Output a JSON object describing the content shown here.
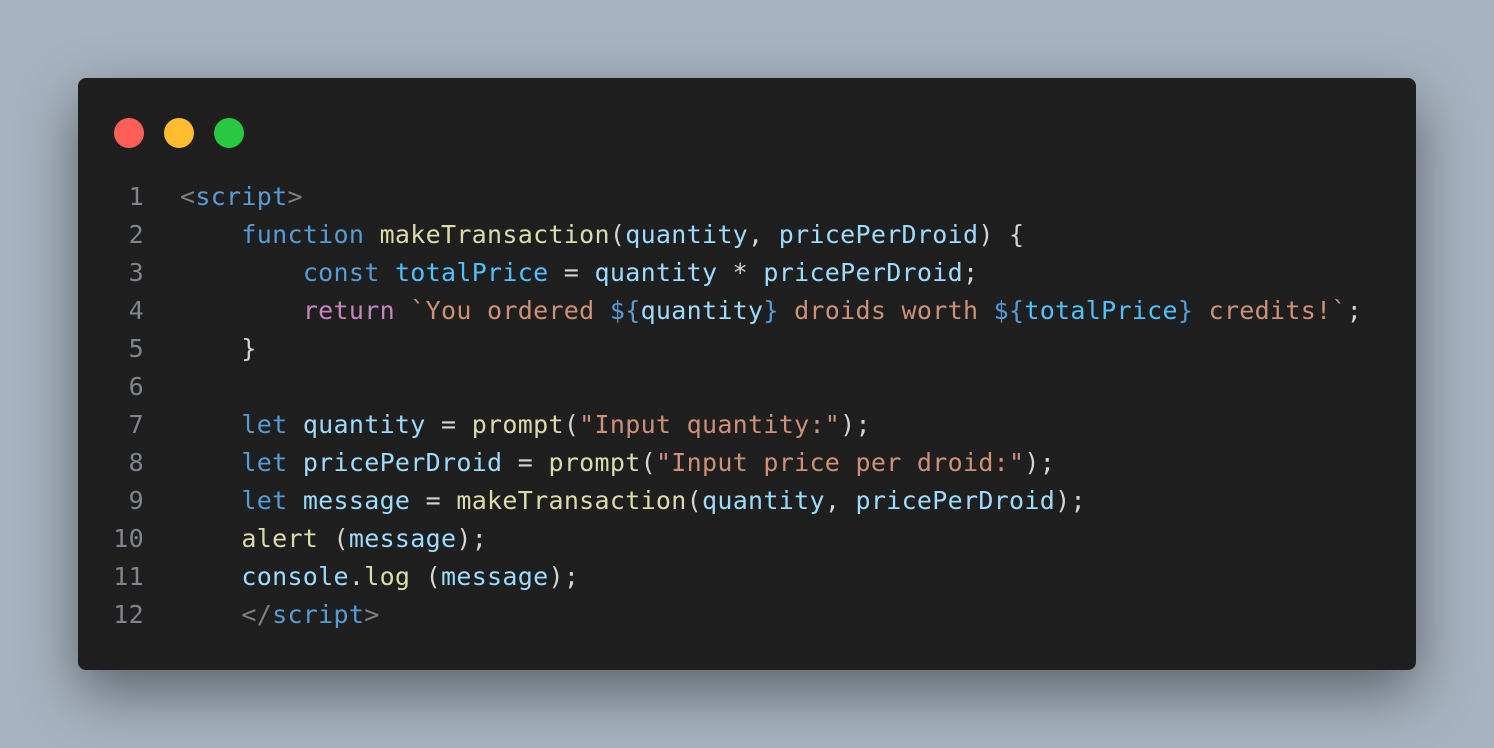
{
  "window": {
    "controls": [
      {
        "name": "close-button",
        "color": "#ff5f57"
      },
      {
        "name": "minimize-button",
        "color": "#febc2e"
      },
      {
        "name": "maximize-button",
        "color": "#28c840"
      }
    ]
  },
  "colors": {
    "background": "#a7b3c0",
    "editor": "#1f1f1f",
    "line_number": "#7f868f"
  },
  "code": {
    "lines": [
      {
        "number": "1",
        "tokens": [
          {
            "type": "tag-br",
            "text": "<"
          },
          {
            "type": "tag",
            "text": "script"
          },
          {
            "type": "tag-br",
            "text": ">"
          }
        ]
      },
      {
        "number": "2",
        "tokens": [
          {
            "type": "punc",
            "text": "    "
          },
          {
            "type": "kw",
            "text": "function"
          },
          {
            "type": "punc",
            "text": " "
          },
          {
            "type": "fn",
            "text": "makeTransaction"
          },
          {
            "type": "punc",
            "text": "("
          },
          {
            "type": "var",
            "text": "quantity"
          },
          {
            "type": "punc",
            "text": ", "
          },
          {
            "type": "var",
            "text": "pricePerDroid"
          },
          {
            "type": "punc",
            "text": ") {"
          }
        ]
      },
      {
        "number": "3",
        "tokens": [
          {
            "type": "punc",
            "text": "        "
          },
          {
            "type": "kw",
            "text": "const"
          },
          {
            "type": "punc",
            "text": " "
          },
          {
            "type": "const",
            "text": "totalPrice"
          },
          {
            "type": "punc",
            "text": " = "
          },
          {
            "type": "var",
            "text": "quantity"
          },
          {
            "type": "punc",
            "text": " * "
          },
          {
            "type": "var",
            "text": "pricePerDroid"
          },
          {
            "type": "punc",
            "text": ";"
          }
        ]
      },
      {
        "number": "4",
        "tokens": [
          {
            "type": "punc",
            "text": "        "
          },
          {
            "type": "ctrl",
            "text": "return"
          },
          {
            "type": "punc",
            "text": " "
          },
          {
            "type": "str",
            "text": "`You ordered "
          },
          {
            "type": "kw",
            "text": "${"
          },
          {
            "type": "var",
            "text": "quantity"
          },
          {
            "type": "kw",
            "text": "}"
          },
          {
            "type": "str",
            "text": " droids worth "
          },
          {
            "type": "kw",
            "text": "${"
          },
          {
            "type": "const",
            "text": "totalPrice"
          },
          {
            "type": "kw",
            "text": "}"
          },
          {
            "type": "str",
            "text": " credits!`"
          },
          {
            "type": "punc",
            "text": ";"
          }
        ]
      },
      {
        "number": "5",
        "tokens": [
          {
            "type": "punc",
            "text": "    }"
          }
        ]
      },
      {
        "number": "6",
        "tokens": []
      },
      {
        "number": "7",
        "tokens": [
          {
            "type": "punc",
            "text": "    "
          },
          {
            "type": "kw",
            "text": "let"
          },
          {
            "type": "punc",
            "text": " "
          },
          {
            "type": "var",
            "text": "quantity"
          },
          {
            "type": "punc",
            "text": " = "
          },
          {
            "type": "fn",
            "text": "prompt"
          },
          {
            "type": "punc",
            "text": "("
          },
          {
            "type": "str",
            "text": "\"Input quantity:\""
          },
          {
            "type": "punc",
            "text": ");"
          }
        ]
      },
      {
        "number": "8",
        "tokens": [
          {
            "type": "punc",
            "text": "    "
          },
          {
            "type": "kw",
            "text": "let"
          },
          {
            "type": "punc",
            "text": " "
          },
          {
            "type": "var",
            "text": "pricePerDroid"
          },
          {
            "type": "punc",
            "text": " = "
          },
          {
            "type": "fn",
            "text": "prompt"
          },
          {
            "type": "punc",
            "text": "("
          },
          {
            "type": "str",
            "text": "\"Input price per droid:\""
          },
          {
            "type": "punc",
            "text": ");"
          }
        ]
      },
      {
        "number": "9",
        "tokens": [
          {
            "type": "punc",
            "text": "    "
          },
          {
            "type": "kw",
            "text": "let"
          },
          {
            "type": "punc",
            "text": " "
          },
          {
            "type": "var",
            "text": "message"
          },
          {
            "type": "punc",
            "text": " = "
          },
          {
            "type": "fn",
            "text": "makeTransaction"
          },
          {
            "type": "punc",
            "text": "("
          },
          {
            "type": "var",
            "text": "quantity"
          },
          {
            "type": "punc",
            "text": ", "
          },
          {
            "type": "var",
            "text": "pricePerDroid"
          },
          {
            "type": "punc",
            "text": ");"
          }
        ]
      },
      {
        "number": "10",
        "tokens": [
          {
            "type": "punc",
            "text": "    "
          },
          {
            "type": "fn",
            "text": "alert"
          },
          {
            "type": "punc",
            "text": " ("
          },
          {
            "type": "var",
            "text": "message"
          },
          {
            "type": "punc",
            "text": ");"
          }
        ]
      },
      {
        "number": "11",
        "tokens": [
          {
            "type": "punc",
            "text": "    "
          },
          {
            "type": "var",
            "text": "console"
          },
          {
            "type": "punc",
            "text": "."
          },
          {
            "type": "fn",
            "text": "log"
          },
          {
            "type": "punc",
            "text": " ("
          },
          {
            "type": "var",
            "text": "message"
          },
          {
            "type": "punc",
            "text": ");"
          }
        ]
      },
      {
        "number": "12",
        "tokens": [
          {
            "type": "punc",
            "text": "    "
          },
          {
            "type": "tag-br",
            "text": "</"
          },
          {
            "type": "tag",
            "text": "script"
          },
          {
            "type": "tag-br",
            "text": ">"
          }
        ]
      }
    ]
  }
}
